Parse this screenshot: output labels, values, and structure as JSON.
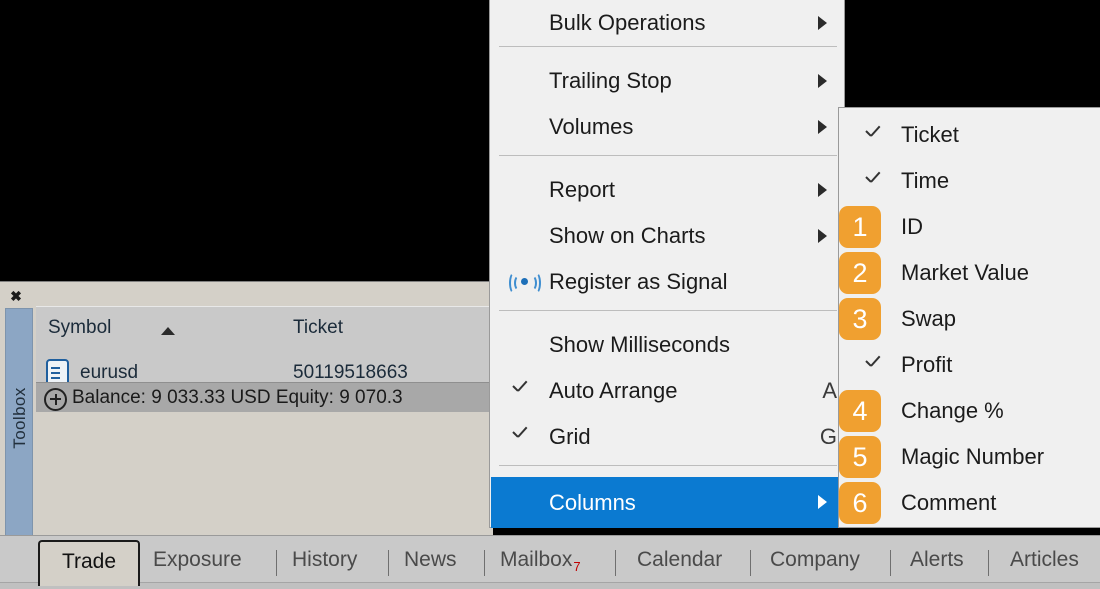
{
  "context_menu": {
    "items": [
      {
        "label": "Bulk Operations",
        "submenu_arrow": true,
        "checked": false,
        "accel": ""
      },
      {
        "label": "Trailing Stop",
        "submenu_arrow": true,
        "checked": false,
        "accel": ""
      },
      {
        "label": "Volumes",
        "submenu_arrow": true,
        "checked": false,
        "accel": ""
      },
      {
        "label": "Report",
        "submenu_arrow": true,
        "checked": false,
        "accel": ""
      },
      {
        "label": "Show on Charts",
        "submenu_arrow": true,
        "checked": false,
        "accel": ""
      },
      {
        "label": "Register as Signal",
        "submenu_arrow": false,
        "checked": false,
        "accel": ""
      },
      {
        "label": "Show Milliseconds",
        "submenu_arrow": false,
        "checked": false,
        "accel": ""
      },
      {
        "label": "Auto Arrange",
        "submenu_arrow": false,
        "checked": true,
        "accel": "A"
      },
      {
        "label": "Grid",
        "submenu_arrow": false,
        "checked": true,
        "accel": "G"
      },
      {
        "label": "Columns",
        "submenu_arrow": true,
        "checked": false,
        "accel": "",
        "selected": true
      }
    ],
    "highlight_color": "#0b7ad1",
    "background_color": "#f0f0f0"
  },
  "columns_submenu": {
    "items": [
      {
        "label": "Ticket",
        "checked": true,
        "badge": ""
      },
      {
        "label": "Time",
        "checked": true,
        "badge": ""
      },
      {
        "label": "ID",
        "checked": false,
        "badge": "1"
      },
      {
        "label": "Market Value",
        "checked": false,
        "badge": "2"
      },
      {
        "label": "Swap",
        "checked": false,
        "badge": "3"
      },
      {
        "label": "Profit",
        "checked": true,
        "badge": ""
      },
      {
        "label": "Change %",
        "checked": false,
        "badge": "4"
      },
      {
        "label": "Magic Number",
        "checked": false,
        "badge": "5"
      },
      {
        "label": "Comment",
        "checked": false,
        "badge": "6"
      }
    ],
    "badge_color": "#f0a030"
  },
  "toolbox": {
    "side_label": "Toolbox",
    "close_glyph": "✖",
    "table": {
      "columns": [
        "Symbol",
        "Ticket"
      ],
      "sort_column": "Symbol",
      "rows": [
        {
          "symbol": "eurusd",
          "ticket": "50119518663"
        }
      ]
    },
    "balance_row": "Balance: 9 033.33 USD  Equity: 9 070.3"
  },
  "tabs": {
    "active": "Trade",
    "items": [
      {
        "label": "Trade",
        "badge": ""
      },
      {
        "label": "Exposure",
        "badge": ""
      },
      {
        "label": "History",
        "badge": ""
      },
      {
        "label": "News",
        "badge": ""
      },
      {
        "label": "Mailbox",
        "badge": "7"
      },
      {
        "label": "Calendar",
        "badge": ""
      },
      {
        "label": "Company",
        "badge": ""
      },
      {
        "label": "Alerts",
        "badge": ""
      },
      {
        "label": "Articles",
        "badge": ""
      }
    ]
  }
}
